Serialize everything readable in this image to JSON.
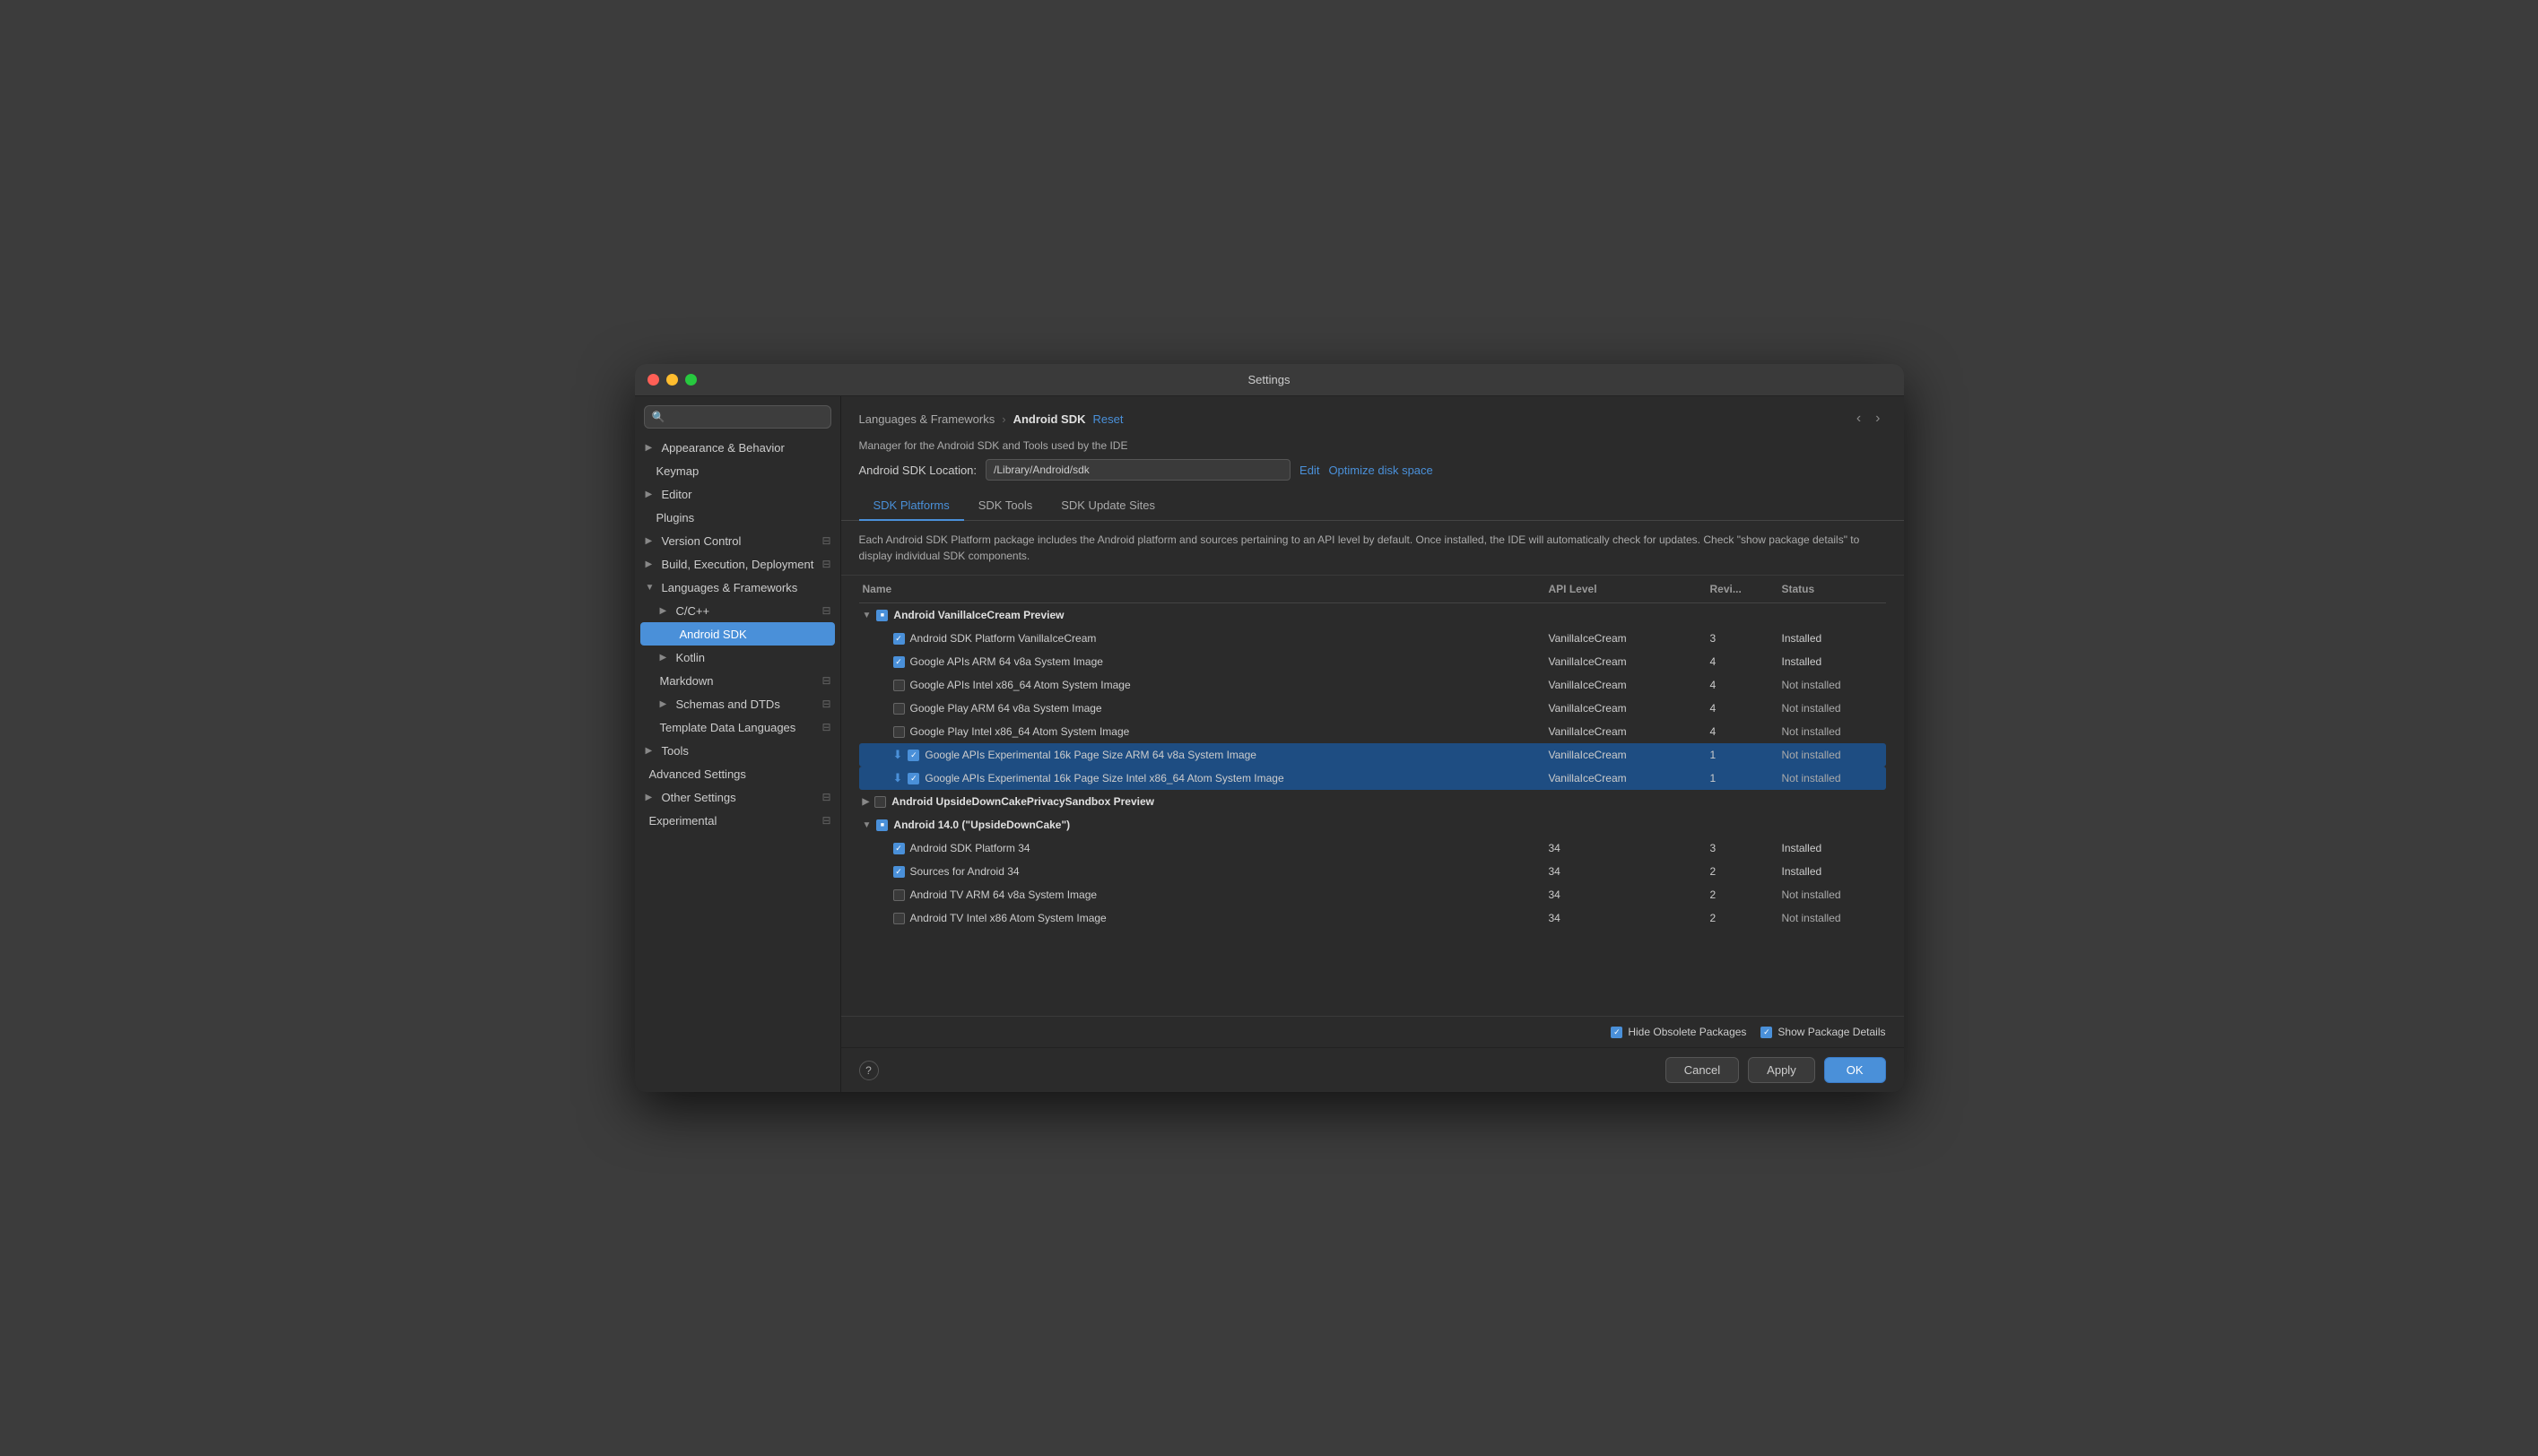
{
  "window": {
    "title": "Settings"
  },
  "breadcrumb": {
    "parent": "Languages & Frameworks",
    "separator": "›",
    "current": "Android SDK",
    "reset": "Reset"
  },
  "description": "Manager for the Android SDK and Tools used by the IDE",
  "sdkLocation": {
    "label": "Android SDK Location:",
    "value": "/Library/Android/sdk",
    "edit": "Edit",
    "optimize": "Optimize disk space"
  },
  "tabs": [
    {
      "id": "platforms",
      "label": "SDK Platforms",
      "active": true
    },
    {
      "id": "tools",
      "label": "SDK Tools",
      "active": false
    },
    {
      "id": "update-sites",
      "label": "SDK Update Sites",
      "active": false
    }
  ],
  "infoText": "Each Android SDK Platform package includes the Android platform and sources pertaining to an API level by default. Once installed, the IDE will automatically check for updates. Check \"show package details\" to display individual SDK components.",
  "tableHeaders": {
    "name": "Name",
    "apiLevel": "API Level",
    "revision": "Revi...",
    "status": "Status"
  },
  "sdkGroups": [
    {
      "id": "vanilla",
      "name": "Android VanillaIceCream Preview",
      "expanded": true,
      "checkState": "indeterminate",
      "items": [
        {
          "name": "Android SDK Platform VanillaIceCream",
          "apiLevel": "VanillaIceCream",
          "revision": "3",
          "status": "Installed",
          "checked": true
        },
        {
          "name": "Google APIs ARM 64 v8a System Image",
          "apiLevel": "VanillaIceCream",
          "revision": "4",
          "status": "Installed",
          "checked": true
        },
        {
          "name": "Google APIs Intel x86_64 Atom System Image",
          "apiLevel": "VanillaIceCream",
          "revision": "4",
          "status": "Not installed",
          "checked": false
        },
        {
          "name": "Google Play ARM 64 v8a System Image",
          "apiLevel": "VanillaIceCream",
          "revision": "4",
          "status": "Not installed",
          "checked": false
        },
        {
          "name": "Google Play Intel x86_64 Atom System Image",
          "apiLevel": "VanillaIceCream",
          "revision": "4",
          "status": "Not installed",
          "checked": false
        },
        {
          "name": "Google APIs Experimental 16k Page Size ARM 64 v8a System Image",
          "apiLevel": "VanillaIceCream",
          "revision": "1",
          "status": "Not installed",
          "checked": true,
          "selected": true,
          "download": true
        },
        {
          "name": "Google APIs Experimental 16k Page Size Intel x86_64 Atom System Image",
          "apiLevel": "VanillaIceCream",
          "revision": "1",
          "status": "Not installed",
          "checked": true,
          "selected": true,
          "download": true
        }
      ]
    },
    {
      "id": "upsidedown",
      "name": "Android UpsideDownCakePrivacySandbox Preview",
      "expanded": false,
      "checkState": "unchecked"
    },
    {
      "id": "android14",
      "name": "Android 14.0 (\"UpsideDownCake\")",
      "expanded": true,
      "checkState": "indeterminate",
      "items": [
        {
          "name": "Android SDK Platform 34",
          "apiLevel": "34",
          "revision": "3",
          "status": "Installed",
          "checked": true
        },
        {
          "name": "Sources for Android 34",
          "apiLevel": "34",
          "revision": "2",
          "status": "Installed",
          "checked": true
        },
        {
          "name": "Android TV ARM 64 v8a System Image",
          "apiLevel": "34",
          "revision": "2",
          "status": "Not installed",
          "checked": false
        },
        {
          "name": "Android TV Intel x86 Atom System Image",
          "apiLevel": "34",
          "revision": "2",
          "status": "Not installed",
          "checked": false
        }
      ]
    }
  ],
  "footerOptions": {
    "hideObsolete": {
      "label": "Hide Obsolete Packages",
      "checked": true
    },
    "showDetails": {
      "label": "Show Package Details",
      "checked": true
    }
  },
  "buttons": {
    "cancel": "Cancel",
    "apply": "Apply",
    "ok": "OK"
  },
  "sidebar": {
    "searchPlaceholder": "🔍",
    "items": [
      {
        "id": "appearance",
        "label": "Appearance & Behavior",
        "indent": 0,
        "hasChevron": true,
        "expanded": false
      },
      {
        "id": "keymap",
        "label": "Keymap",
        "indent": 0,
        "hasChevron": false
      },
      {
        "id": "editor",
        "label": "Editor",
        "indent": 0,
        "hasChevron": true,
        "expanded": false
      },
      {
        "id": "plugins",
        "label": "Plugins",
        "indent": 0,
        "hasChevron": false
      },
      {
        "id": "version-control",
        "label": "Version Control",
        "indent": 0,
        "hasChevron": true,
        "hasIcon": true
      },
      {
        "id": "build-execution",
        "label": "Build, Execution, Deployment",
        "indent": 0,
        "hasChevron": true,
        "hasIcon": true
      },
      {
        "id": "languages",
        "label": "Languages & Frameworks",
        "indent": 0,
        "hasChevron": true,
        "expanded": true
      },
      {
        "id": "cpp",
        "label": "C/C++",
        "indent": 1,
        "hasChevron": true,
        "hasIcon": true
      },
      {
        "id": "android-sdk",
        "label": "Android SDK",
        "indent": 2,
        "active": true
      },
      {
        "id": "kotlin",
        "label": "Kotlin",
        "indent": 1,
        "hasChevron": true
      },
      {
        "id": "markdown",
        "label": "Markdown",
        "indent": 1,
        "hasIcon": true
      },
      {
        "id": "schemas",
        "label": "Schemas and DTDs",
        "indent": 1,
        "hasChevron": true,
        "hasIcon": true
      },
      {
        "id": "template-data",
        "label": "Template Data Languages",
        "indent": 1,
        "hasIcon": true
      },
      {
        "id": "tools",
        "label": "Tools",
        "indent": 0,
        "hasChevron": true
      },
      {
        "id": "advanced",
        "label": "Advanced Settings",
        "indent": 0
      },
      {
        "id": "other",
        "label": "Other Settings",
        "indent": 0,
        "hasChevron": true,
        "hasIcon": true
      },
      {
        "id": "experimental",
        "label": "Experimental",
        "indent": 0,
        "hasIcon": true
      }
    ]
  }
}
